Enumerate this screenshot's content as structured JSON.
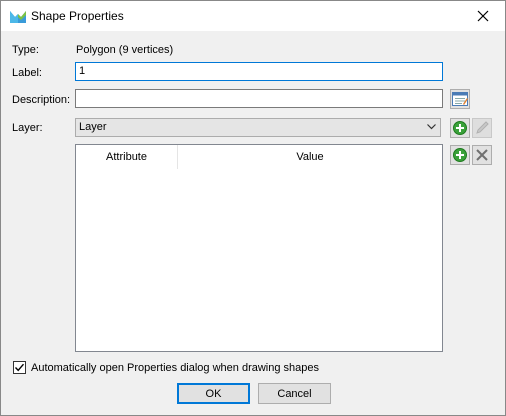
{
  "window": {
    "title": "Shape Properties",
    "close_icon": "close-icon",
    "app_icon": "app-logo-icon"
  },
  "form": {
    "type_label": "Type:",
    "type_value": "Polygon (9 vertices)",
    "label_label": "Label:",
    "label_value": "1",
    "description_label": "Description:",
    "description_value": "",
    "layer_label": "Layer:",
    "layer_value": "Layer"
  },
  "grid": {
    "columns": [
      "Attribute",
      "Value"
    ],
    "rows": []
  },
  "options": {
    "auto_open_label": "Automatically open Properties dialog when drawing shapes",
    "auto_open_checked": true
  },
  "buttons": {
    "ok": "OK",
    "cancel": "Cancel"
  },
  "colors": {
    "accent": "#0078d7",
    "add_green": "#3aa13a"
  }
}
